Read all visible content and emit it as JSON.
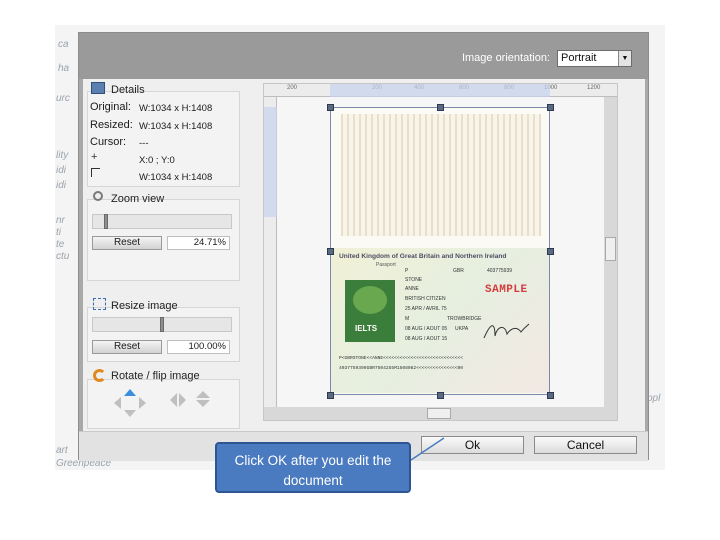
{
  "background": {
    "fragments": [
      "ca",
      "ha",
      "urc",
      "lity",
      "idi",
      "idi",
      "nr",
      "ti",
      "te",
      "ctu",
      "ppl",
      "art",
      "Greenpeace"
    ]
  },
  "dialog": {
    "orientation_label": "Image orientation:",
    "orientation_value": "Portrait",
    "details": {
      "title": "Details",
      "original_label": "Original:",
      "original_value": "W:1034 x H:1408",
      "resized_label": "Resized:",
      "resized_value": "W:1034 x H:1408",
      "cursor_label": "Cursor:",
      "cursor_value": "---",
      "position_value": "X:0 ; Y:0",
      "size_value": "W:1034 x H:1408"
    },
    "zoom": {
      "title": "Zoom view",
      "level": 0.08,
      "reset_label": "Reset",
      "percent": "24.71%"
    },
    "resize": {
      "title": "Resize image",
      "level": 0.5,
      "reset_label": "Reset",
      "percent": "100.00%"
    },
    "rotate": {
      "title": "Rotate / flip image"
    },
    "ruler": {
      "ticks": [
        "200",
        "",
        "200",
        "400",
        "600",
        "800",
        "1000",
        "1200"
      ]
    },
    "document": {
      "heading": "United Kingdom of Great Britain and Northern Ireland",
      "passport_label": "Passport",
      "type": "P",
      "code": "GBR",
      "number": "403775939",
      "surname": "STONE",
      "given_name": "ANNE",
      "nationality": "BRITISH CITIZEN",
      "dob": "25 APR / AVRIL 75",
      "sex": "M",
      "place": "TROWBRIDGE",
      "issue": "08 AUG / AOUT 05",
      "authority": "UKPA",
      "expiry": "08 AUG / AOUT 15",
      "sample": "SAMPLE",
      "ielts": "IELTS",
      "mrz1": "P<GBRSTONE<<ANNE<<<<<<<<<<<<<<<<<<<<<<<<<<<<<",
      "mrz2": "4037759390GBR7504255M1508082<<<<<<<<<<<<<<<00"
    },
    "ok_label": "Ok",
    "cancel_label": "Cancel"
  },
  "callout": {
    "text": "Click OK after you edit the document"
  },
  "colors": {
    "callout": "#4a7abf",
    "sample_red": "#d23c3c",
    "dialog_gray": "#a9a9a9"
  }
}
